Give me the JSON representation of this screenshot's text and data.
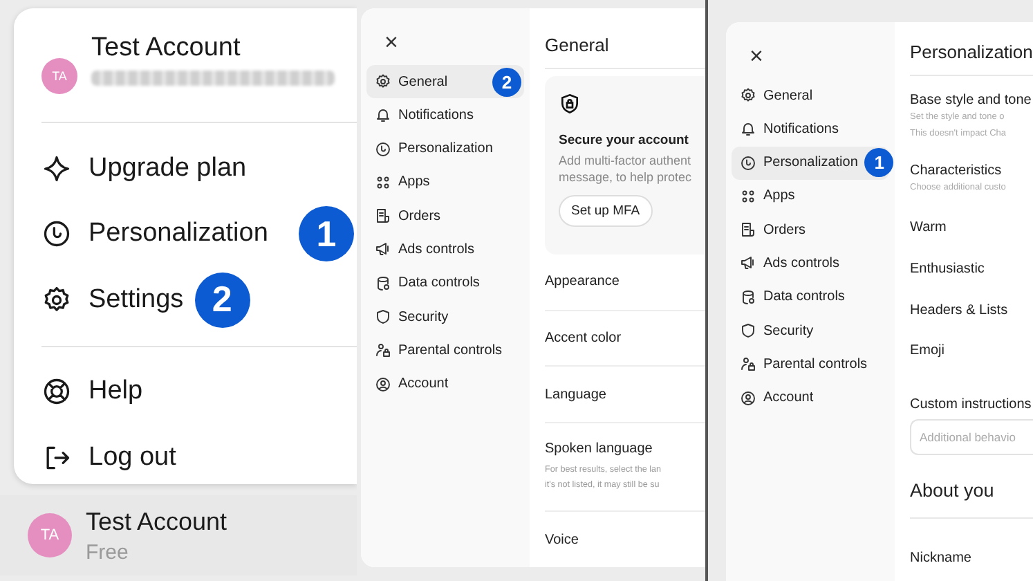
{
  "account_menu": {
    "account": {
      "avatar": "TA",
      "name": "Test Account"
    },
    "sections": [
      [
        {
          "label": "Upgrade plan"
        },
        {
          "label": "Personalization",
          "badge": "1"
        },
        {
          "label": "Settings",
          "badge": "2"
        }
      ],
      [
        {
          "label": "Help"
        },
        {
          "label": "Log out"
        }
      ]
    ],
    "footer": {
      "avatar": "TA",
      "name": "Test Account",
      "plan": "Free"
    }
  },
  "settings_general": {
    "close": "×",
    "sidebar": [
      {
        "label": "General",
        "selected": true,
        "badge": "2"
      },
      {
        "label": "Notifications",
        "selected": false
      },
      {
        "label": "Personalization",
        "selected": false
      },
      {
        "label": "Apps",
        "selected": false
      },
      {
        "label": "Orders",
        "selected": false
      },
      {
        "label": "Ads controls",
        "selected": false
      },
      {
        "label": "Data controls",
        "selected": false
      },
      {
        "label": "Security",
        "selected": false
      },
      {
        "label": "Parental controls",
        "selected": false
      },
      {
        "label": "Account",
        "selected": false
      }
    ],
    "title": "General",
    "security_card": {
      "title": "Secure your account",
      "lines": [
        "Add multi-factor authent",
        "message, to help protec"
      ],
      "button": "Set up MFA"
    },
    "rows": [
      {
        "label": "Appearance"
      },
      {
        "label": "Accent color"
      },
      {
        "label": "Language"
      },
      {
        "label": "Spoken language",
        "description": [
          "For best results, select the lan",
          "it's not listed, it may still be su"
        ]
      },
      {
        "label": "Voice"
      }
    ]
  },
  "settings_personalization": {
    "close": "×",
    "sidebar": [
      {
        "label": "General",
        "selected": false
      },
      {
        "label": "Notifications",
        "selected": false
      },
      {
        "label": "Personalization",
        "selected": true,
        "badge": "1"
      },
      {
        "label": "Apps",
        "selected": false
      },
      {
        "label": "Orders",
        "selected": false
      },
      {
        "label": "Ads controls",
        "selected": false
      },
      {
        "label": "Data controls",
        "selected": false
      },
      {
        "label": "Security",
        "selected": false
      },
      {
        "label": "Parental controls",
        "selected": false
      },
      {
        "label": "Account",
        "selected": false
      }
    ],
    "title": "Personalization",
    "items": [
      {
        "kind": "setting",
        "label": "Base style and tone",
        "description": [
          "Set the style and tone o",
          "This doesn't impact Cha"
        ]
      },
      {
        "kind": "setting",
        "label": "Characteristics",
        "description": [
          "Choose additional custo"
        ]
      },
      {
        "kind": "option",
        "label": "Warm"
      },
      {
        "kind": "option",
        "label": "Enthusiastic"
      },
      {
        "kind": "option",
        "label": "Headers & Lists"
      },
      {
        "kind": "option",
        "label": "Emoji"
      },
      {
        "kind": "field",
        "label": "Custom instructions",
        "placeholder": "Additional behavio"
      },
      {
        "kind": "heading",
        "label": "About you"
      },
      {
        "kind": "option",
        "label": "Nickname"
      }
    ]
  }
}
